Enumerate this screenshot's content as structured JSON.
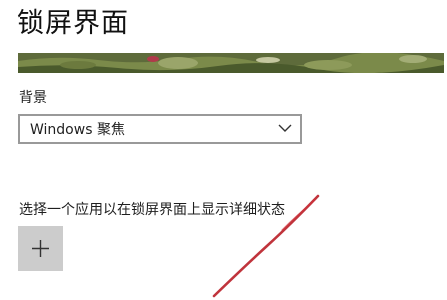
{
  "page": {
    "title": "锁屏界面"
  },
  "background": {
    "label": "背景",
    "selected": "Windows 聚焦"
  },
  "detailed_status": {
    "label": "选择一个应用以在锁屏界面上显示详细状态"
  },
  "icons": {
    "chevron": "chevron-down-icon",
    "add": "plus-icon"
  },
  "colors": {
    "add_button_bg": "#cccccc",
    "dropdown_border": "#999999",
    "annotation": "#b5111a"
  }
}
